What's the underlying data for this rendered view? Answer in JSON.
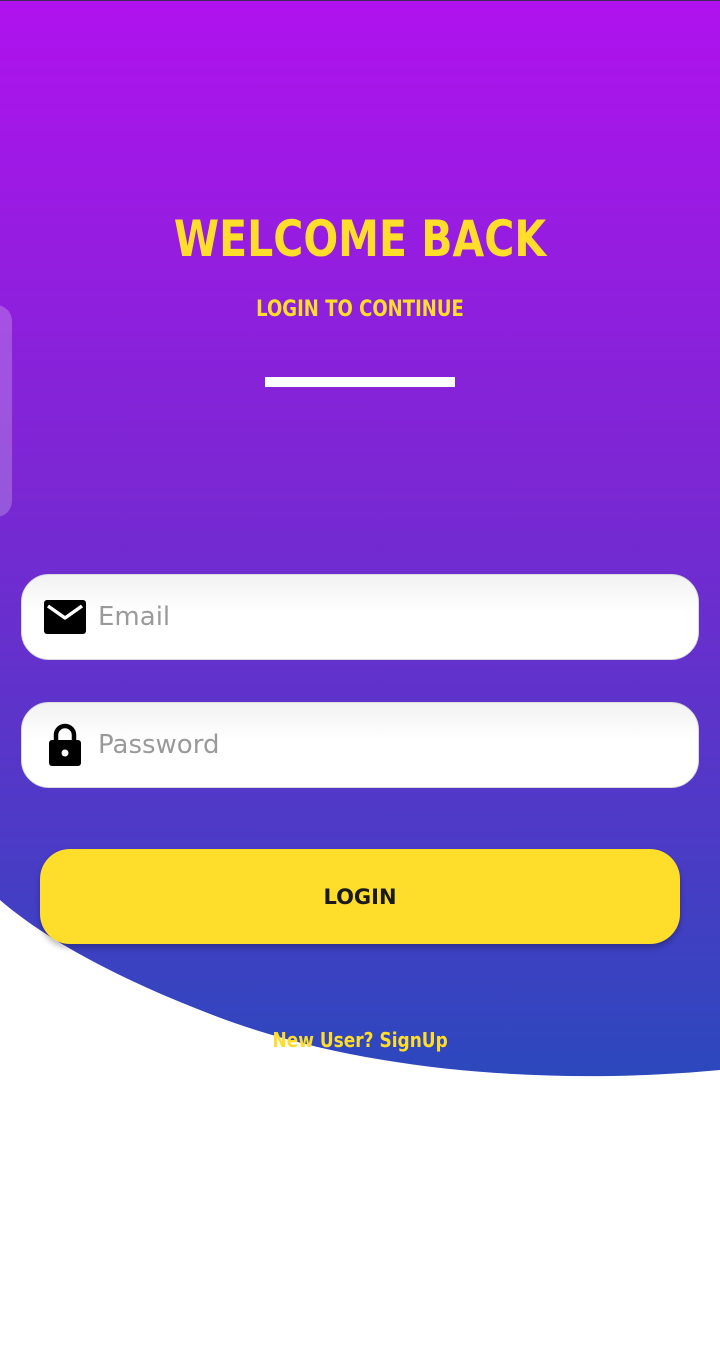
{
  "welcome": {
    "title": "WELCOME BACK",
    "subtitle": "LOGIN TO CONTINUE"
  },
  "form": {
    "email_placeholder": "Email",
    "password_placeholder": "Password",
    "login_label": "LOGIN",
    "signup_link": "New User? SignUp"
  },
  "icons": {
    "email": "mail-icon",
    "password": "lock-icon"
  },
  "colors": {
    "gradient_top": "#b012ee",
    "gradient_bottom": "#2c48bd",
    "accent": "#ffdd2b",
    "divider": "#ffffff",
    "background": "#ffffff"
  }
}
